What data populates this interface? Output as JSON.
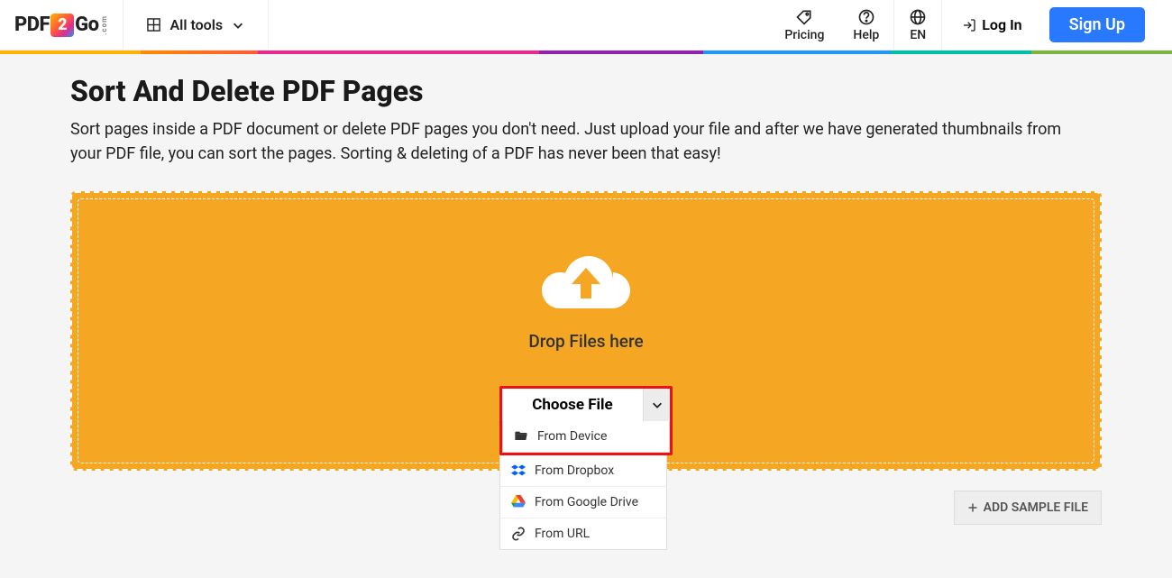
{
  "header": {
    "logo_pre": "PDF",
    "logo_mid": "2",
    "logo_post": "Go",
    "logo_sub": ".com",
    "all_tools": "All tools",
    "pricing": "Pricing",
    "help": "Help",
    "lang": "EN",
    "login": "Log In",
    "signup": "Sign Up"
  },
  "page": {
    "title": "Sort And Delete PDF Pages",
    "description": "Sort pages inside a PDF document or delete PDF pages you don't need. Just upload your file and after we have generated thumbnails from your PDF file, you can sort the pages. Sorting & deleting of a PDF has never been that easy!",
    "drop_label": "Drop Files here",
    "choose_file": "Choose File",
    "add_sample": "ADD SAMPLE FILE"
  },
  "menu": {
    "device": "From Device",
    "dropbox": "From Dropbox",
    "gdrive": "From Google Drive",
    "url": "From URL"
  }
}
